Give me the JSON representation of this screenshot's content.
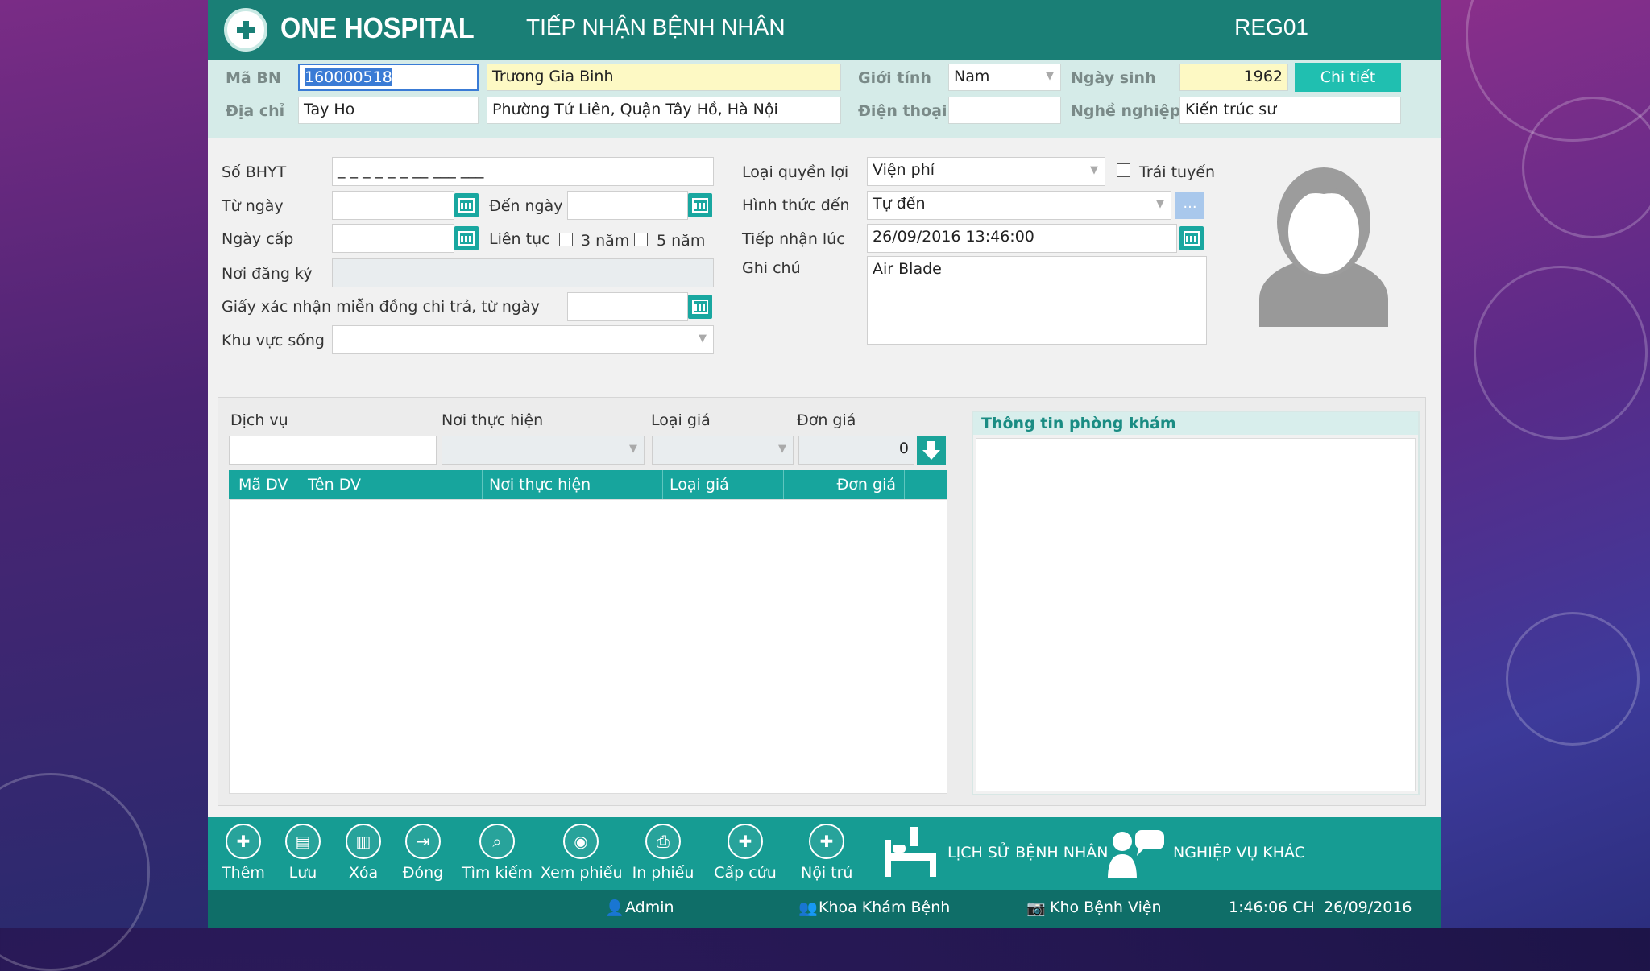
{
  "header": {
    "brand": "ONE HOSPITAL",
    "title": "TIẾP NHẬN BỆNH NHÂN",
    "code": "REG01"
  },
  "patient": {
    "ma_bn_label": "Mã BN",
    "ma_bn": "160000518",
    "name": "Trương Gia Binh",
    "gioi_tinh_label": "Giới tính",
    "gioi_tinh": "Nam",
    "ngay_sinh_label": "Ngày sinh",
    "ngay_sinh": "1962",
    "detail_button": "Chi tiết",
    "dia_chi_label": "Địa chỉ",
    "dia_chi_short": "Tay Ho",
    "dia_chi_full": "Phường Tứ Liên, Quận Tây Hồ, Hà Nội",
    "dien_thoai_label": "Điện thoại",
    "dien_thoai": "",
    "nghe_nghiep_label": "Nghề nghiệp",
    "nghe_nghiep": "Kiến trúc sư"
  },
  "insurance": {
    "so_bhyt_label": "Số BHYT",
    "so_bhyt_mask": "_ _ _ _ _ _ __ ___ ___",
    "tu_ngay_label": "Từ ngày",
    "den_ngay_label": "Đến ngày",
    "ngay_cap_label": "Ngày cấp",
    "lien_tuc_label": "Liên tục",
    "three_years": "3 năm",
    "five_years": "5 năm",
    "noi_dang_ky_label": "Nơi đăng ký",
    "giay_xac_nhan_label": "Giấy xác nhận miễn đồng chi trả, từ ngày",
    "khu_vuc_song_label": "Khu vực sống"
  },
  "reception": {
    "loai_quyen_loi_label": "Loại quyền lợi",
    "loai_quyen_loi": "Viện phí",
    "trai_tuyen_label": "Trái tuyến",
    "hinh_thuc_den_label": "Hình thức đến",
    "hinh_thuc_den": "Tự đến",
    "more_button": "...",
    "tiep_nhan_luc_label": "Tiếp nhận lúc",
    "tiep_nhan_luc": "26/09/2016 13:46:00",
    "ghi_chu_label": "Ghi chú",
    "ghi_chu": "Air Blade"
  },
  "service": {
    "dich_vu_label": "Dịch vụ",
    "noi_thuc_hien_label": "Nơi thực hiện",
    "loai_gia_label": "Loại giá",
    "don_gia_label": "Đơn giá",
    "don_gia_value": "0",
    "columns": [
      "Mã DV",
      "Tên DV",
      "Nơi thực hiện",
      "Loại giá",
      "Đơn giá"
    ]
  },
  "clinic_panel": {
    "title": "Thông tin phòng khám"
  },
  "toolbar": {
    "them": "Thêm",
    "luu": "Lưu",
    "xoa": "Xóa",
    "dong": "Đóng",
    "tim_kiem": "Tìm kiếm",
    "xem_phieu": "Xem phiếu",
    "in_phieu": "In phiếu",
    "cap_cuu": "Cấp cứu",
    "noi_tru": "Nội trú",
    "lich_su": "LỊCH SỬ BỆNH NHÂN",
    "nghiep_vu": "NGHIỆP VỤ KHÁC"
  },
  "status": {
    "user": "Admin",
    "department": "Khoa Khám Bệnh",
    "warehouse": "Kho Bệnh Viện",
    "time": "1:46:06 CH",
    "date": "26/09/2016"
  },
  "colors": {
    "primary": "#1a7f76",
    "accent": "#20bfb0",
    "highlight": "#fdf9c4"
  }
}
